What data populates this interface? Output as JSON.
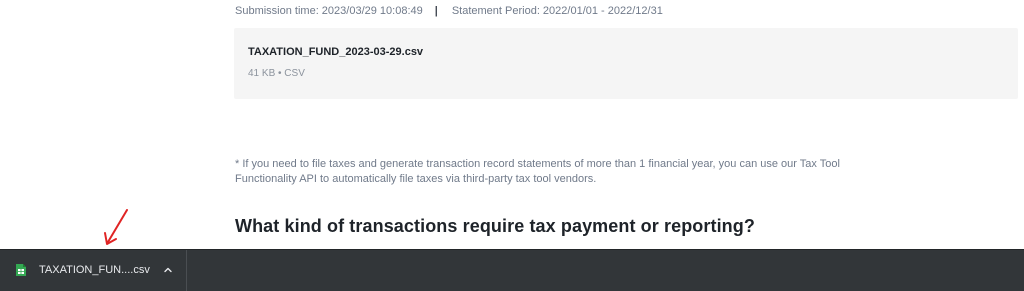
{
  "statement": {
    "submission_time": "Submission time: 2023/03/29 10:08:49",
    "separator": "|",
    "statement_period": "Statement Period: 2022/01/01 - 2022/12/31",
    "file_name": "TAXATION_FUND_2023-03-29.csv",
    "file_info": "41 KB • CSV"
  },
  "note": "* If you need to file taxes and generate transaction record statements of more than 1 financial year, you can use our Tax Tool Functionality API to automatically file taxes via third-party tax tool vendors.",
  "section_heading": "What kind of transactions require tax payment or reporting?",
  "download_bar": {
    "item_label": "TAXATION_FUN....csv",
    "icon": "spreadsheet-file-icon",
    "chevron": "chevron-up-icon"
  },
  "colors": {
    "annotation_arrow": "#e02424",
    "download_bar_bg": "#323639",
    "file_icon": "#34a853"
  }
}
